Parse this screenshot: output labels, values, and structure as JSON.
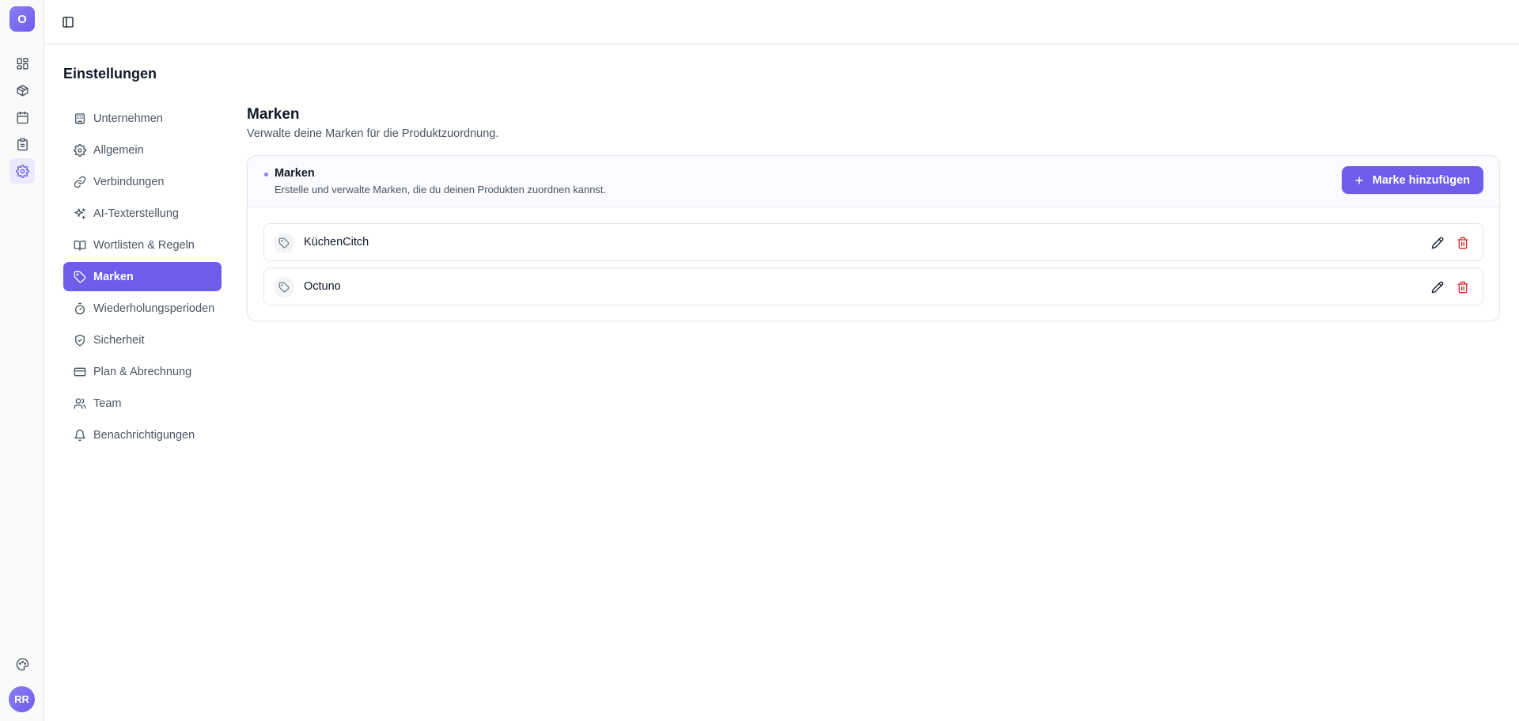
{
  "rail": {
    "org_initial": "O",
    "user_initials": "RR",
    "items": [
      {
        "icon": "dashboard-icon"
      },
      {
        "icon": "package-icon"
      },
      {
        "icon": "calendar-icon"
      },
      {
        "icon": "clipboard-icon"
      },
      {
        "icon": "gear-icon",
        "active": true
      }
    ],
    "bottom_icon": "palette-icon"
  },
  "topbar": {
    "toggle_icon": "sidebar-toggle-icon"
  },
  "settings": {
    "title": "Einstellungen",
    "nav": [
      {
        "label": "Unternehmen",
        "icon": "building-icon"
      },
      {
        "label": "Allgemein",
        "icon": "gear-icon"
      },
      {
        "label": "Verbindungen",
        "icon": "link-icon"
      },
      {
        "label": "AI-Texterstellung",
        "icon": "sparkles-icon"
      },
      {
        "label": "Wortlisten & Regeln",
        "icon": "book-icon"
      },
      {
        "label": "Marken",
        "icon": "tag-icon",
        "active": true
      },
      {
        "label": "Wiederholungsperioden",
        "icon": "timer-icon"
      },
      {
        "label": "Sicherheit",
        "icon": "shield-check-icon"
      },
      {
        "label": "Plan & Abrechnung",
        "icon": "credit-card-icon"
      },
      {
        "label": "Team",
        "icon": "users-icon"
      },
      {
        "label": "Benachrichtigungen",
        "icon": "bell-icon"
      }
    ]
  },
  "section": {
    "title": "Marken",
    "subtitle": "Verwalte deine Marken für die Produktzuordnung."
  },
  "card": {
    "title": "Marken",
    "description": "Erstelle und verwalte Marken, die du deinen Produkten zuordnen kannst.",
    "add_label": "Marke hinzufügen",
    "brands": [
      {
        "name": "KüchenCitch"
      },
      {
        "name": "Octuno"
      }
    ]
  },
  "colors": {
    "accent": "#6d5dea",
    "danger": "#dc2626",
    "text": "#111827",
    "muted": "#4b5563"
  }
}
